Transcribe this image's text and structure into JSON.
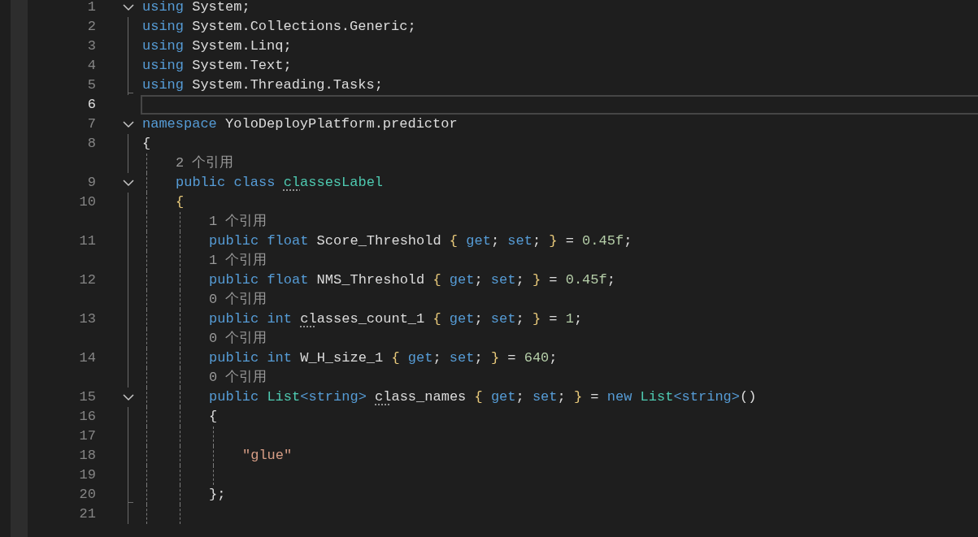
{
  "editor": {
    "rows": [
      {
        "kind": "code",
        "number": "1",
        "gutter": {
          "kind": "chevron",
          "expanded": true
        },
        "current": false,
        "tokens": [
          {
            "kind": "keyword",
            "text": "using"
          },
          {
            "kind": "plain",
            "text": " System;"
          }
        ]
      },
      {
        "kind": "code",
        "number": "2",
        "gutter": {
          "kind": "line"
        },
        "current": false,
        "tokens": [
          {
            "kind": "keyword",
            "text": "using"
          },
          {
            "kind": "plain",
            "text": " System.Collections.Generic;"
          }
        ]
      },
      {
        "kind": "code",
        "number": "3",
        "gutter": {
          "kind": "line"
        },
        "current": false,
        "tokens": [
          {
            "kind": "keyword",
            "text": "using"
          },
          {
            "kind": "plain",
            "text": " System.Linq;"
          }
        ]
      },
      {
        "kind": "code",
        "number": "4",
        "gutter": {
          "kind": "line"
        },
        "current": false,
        "tokens": [
          {
            "kind": "keyword",
            "text": "using"
          },
          {
            "kind": "plain",
            "text": " System.Text;"
          }
        ]
      },
      {
        "kind": "code",
        "number": "5",
        "gutter": {
          "kind": "end"
        },
        "current": false,
        "tokens": [
          {
            "kind": "keyword",
            "text": "using"
          },
          {
            "kind": "plain",
            "text": " System.Threading.Tasks;"
          }
        ]
      },
      {
        "kind": "code",
        "number": "6",
        "current": true
      },
      {
        "kind": "code",
        "number": "7",
        "gutter": {
          "kind": "chevron",
          "expanded": true
        },
        "current": false,
        "tokens": [
          {
            "kind": "keyword",
            "text": "namespace"
          },
          {
            "kind": "plain",
            "text": " YoloDeployPlatform.predictor"
          }
        ]
      },
      {
        "kind": "code",
        "number": "8",
        "gutter": {
          "kind": "line"
        },
        "current": false,
        "tokens": [
          {
            "kind": "plain",
            "text": "{"
          }
        ]
      },
      {
        "kind": "lens",
        "gutter": {
          "kind": "line"
        },
        "guides": [
          {
            "kind": "dashed"
          }
        ],
        "text": "2 个引用"
      },
      {
        "kind": "code",
        "number": "9",
        "gutter": {
          "kind": "chevron",
          "expanded": true
        },
        "guides": [
          {
            "kind": "dashed"
          }
        ],
        "current": false,
        "tokens": [
          {
            "kind": "keyword",
            "text": "public class "
          },
          {
            "kind": "type",
            "text": "cl",
            "dots": true
          },
          {
            "kind": "type",
            "text": "assesLabel"
          }
        ]
      },
      {
        "kind": "code",
        "number": "10",
        "gutter": {
          "kind": "line"
        },
        "guides": [
          {
            "kind": "dashed"
          }
        ],
        "current": false,
        "tokens": [
          {
            "kind": "brace",
            "text": "{"
          }
        ]
      },
      {
        "kind": "lens",
        "gutter": {
          "kind": "line"
        },
        "guides": [
          {
            "kind": "dashed"
          },
          {
            "kind": "dashed"
          }
        ],
        "text": "1 个引用"
      },
      {
        "kind": "code",
        "number": "11",
        "gutter": {
          "kind": "line"
        },
        "guides": [
          {
            "kind": "dashed"
          },
          {
            "kind": "dashed"
          }
        ],
        "current": false,
        "tokens": [
          {
            "kind": "keyword",
            "text": "public float"
          },
          {
            "kind": "plain",
            "text": " Score_Threshold "
          },
          {
            "kind": "brace",
            "text": "{"
          },
          {
            "kind": "keyword",
            "text": " get"
          },
          {
            "kind": "plain",
            "text": ";"
          },
          {
            "kind": "keyword",
            "text": " set"
          },
          {
            "kind": "plain",
            "text": "; "
          },
          {
            "kind": "brace",
            "text": "}"
          },
          {
            "kind": "plain",
            "text": " = "
          },
          {
            "kind": "number",
            "text": "0.45f"
          },
          {
            "kind": "plain",
            "text": ";"
          }
        ]
      },
      {
        "kind": "lens",
        "gutter": {
          "kind": "line"
        },
        "guides": [
          {
            "kind": "dashed"
          },
          {
            "kind": "dashed"
          }
        ],
        "text": "1 个引用"
      },
      {
        "kind": "code",
        "number": "12",
        "gutter": {
          "kind": "line"
        },
        "guides": [
          {
            "kind": "dashed"
          },
          {
            "kind": "dashed"
          }
        ],
        "current": false,
        "tokens": [
          {
            "kind": "keyword",
            "text": "public float"
          },
          {
            "kind": "plain",
            "text": " NMS_Threshold "
          },
          {
            "kind": "brace",
            "text": "{"
          },
          {
            "kind": "keyword",
            "text": " get"
          },
          {
            "kind": "plain",
            "text": ";"
          },
          {
            "kind": "keyword",
            "text": " set"
          },
          {
            "kind": "plain",
            "text": "; "
          },
          {
            "kind": "brace",
            "text": "}"
          },
          {
            "kind": "plain",
            "text": " = "
          },
          {
            "kind": "number",
            "text": "0.45f"
          },
          {
            "kind": "plain",
            "text": ";"
          }
        ]
      },
      {
        "kind": "lens",
        "gutter": {
          "kind": "line"
        },
        "guides": [
          {
            "kind": "dashed"
          },
          {
            "kind": "dashed"
          }
        ],
        "text": "0 个引用"
      },
      {
        "kind": "code",
        "number": "13",
        "gutter": {
          "kind": "line"
        },
        "guides": [
          {
            "kind": "dashed"
          },
          {
            "kind": "dashed"
          }
        ],
        "current": false,
        "tokens": [
          {
            "kind": "keyword",
            "text": "public int "
          },
          {
            "kind": "plain",
            "text": "cl",
            "dots": true
          },
          {
            "kind": "plain",
            "text": "asses_count_1 "
          },
          {
            "kind": "brace",
            "text": "{"
          },
          {
            "kind": "keyword",
            "text": " get"
          },
          {
            "kind": "plain",
            "text": ";"
          },
          {
            "kind": "keyword",
            "text": " set"
          },
          {
            "kind": "plain",
            "text": "; "
          },
          {
            "kind": "brace",
            "text": "}"
          },
          {
            "kind": "plain",
            "text": " = "
          },
          {
            "kind": "number",
            "text": "1"
          },
          {
            "kind": "plain",
            "text": ";"
          }
        ]
      },
      {
        "kind": "lens",
        "gutter": {
          "kind": "line"
        },
        "guides": [
          {
            "kind": "dashed"
          },
          {
            "kind": "dashed"
          }
        ],
        "text": "0 个引用"
      },
      {
        "kind": "code",
        "number": "14",
        "gutter": {
          "kind": "line"
        },
        "guides": [
          {
            "kind": "dashed"
          },
          {
            "kind": "dashed"
          }
        ],
        "current": false,
        "tokens": [
          {
            "kind": "keyword",
            "text": "public int"
          },
          {
            "kind": "plain",
            "text": " W_H_size_1 "
          },
          {
            "kind": "brace",
            "text": "{"
          },
          {
            "kind": "keyword",
            "text": " get"
          },
          {
            "kind": "plain",
            "text": ";"
          },
          {
            "kind": "keyword",
            "text": " set"
          },
          {
            "kind": "plain",
            "text": "; "
          },
          {
            "kind": "brace",
            "text": "}"
          },
          {
            "kind": "plain",
            "text": " = "
          },
          {
            "kind": "number",
            "text": "640"
          },
          {
            "kind": "plain",
            "text": ";"
          }
        ]
      },
      {
        "kind": "lens",
        "gutter": {
          "kind": "line"
        },
        "guides": [
          {
            "kind": "dashed"
          },
          {
            "kind": "dashed"
          }
        ],
        "text": "0 个引用"
      },
      {
        "kind": "code",
        "number": "15",
        "gutter": {
          "kind": "chevron",
          "expanded": true
        },
        "guides": [
          {
            "kind": "dashed"
          },
          {
            "kind": "dashed"
          }
        ],
        "current": false,
        "tokens": [
          {
            "kind": "keyword",
            "text": "public "
          },
          {
            "kind": "type",
            "text": "List"
          },
          {
            "kind": "keyword",
            "text": "<string> "
          },
          {
            "kind": "plain",
            "text": "cl",
            "dots": true
          },
          {
            "kind": "plain",
            "text": "ass_names "
          },
          {
            "kind": "brace",
            "text": "{"
          },
          {
            "kind": "keyword",
            "text": " get"
          },
          {
            "kind": "plain",
            "text": ";"
          },
          {
            "kind": "keyword",
            "text": " set"
          },
          {
            "kind": "plain",
            "text": "; "
          },
          {
            "kind": "brace",
            "text": "}"
          },
          {
            "kind": "plain",
            "text": " = "
          },
          {
            "kind": "keyword",
            "text": "new "
          },
          {
            "kind": "type",
            "text": "List"
          },
          {
            "kind": "keyword",
            "text": "<string>"
          },
          {
            "kind": "plain",
            "text": "()"
          }
        ]
      },
      {
        "kind": "code",
        "number": "16",
        "gutter": {
          "kind": "line"
        },
        "guides": [
          {
            "kind": "dashed"
          },
          {
            "kind": "dashed"
          }
        ],
        "current": false,
        "tokens": [
          {
            "kind": "plain",
            "text": "{"
          }
        ]
      },
      {
        "kind": "code",
        "number": "17",
        "gutter": {
          "kind": "line"
        },
        "guides": [
          {
            "kind": "dashed"
          },
          {
            "kind": "dashed"
          },
          {
            "kind": "dashed"
          }
        ],
        "current": false
      },
      {
        "kind": "code",
        "number": "18",
        "gutter": {
          "kind": "line"
        },
        "guides": [
          {
            "kind": "dashed"
          },
          {
            "kind": "dashed"
          },
          {
            "kind": "dashed"
          }
        ],
        "current": false,
        "tokens": [
          {
            "kind": "string",
            "text": "\"glue\""
          }
        ]
      },
      {
        "kind": "code",
        "number": "19",
        "gutter": {
          "kind": "line"
        },
        "guides": [
          {
            "kind": "dashed"
          },
          {
            "kind": "dashed"
          },
          {
            "kind": "dashed"
          }
        ],
        "current": false
      },
      {
        "kind": "code",
        "number": "20",
        "gutter": {
          "kind": "end"
        },
        "guides": [
          {
            "kind": "dashed"
          },
          {
            "kind": "dashed"
          }
        ],
        "current": false,
        "tokens": [
          {
            "kind": "plain",
            "text": "};"
          }
        ]
      },
      {
        "kind": "code",
        "number": "21",
        "gutter": {
          "kind": "line"
        },
        "guides": [
          {
            "kind": "dashed"
          },
          {
            "kind": "dashed"
          }
        ],
        "current": false
      }
    ]
  }
}
